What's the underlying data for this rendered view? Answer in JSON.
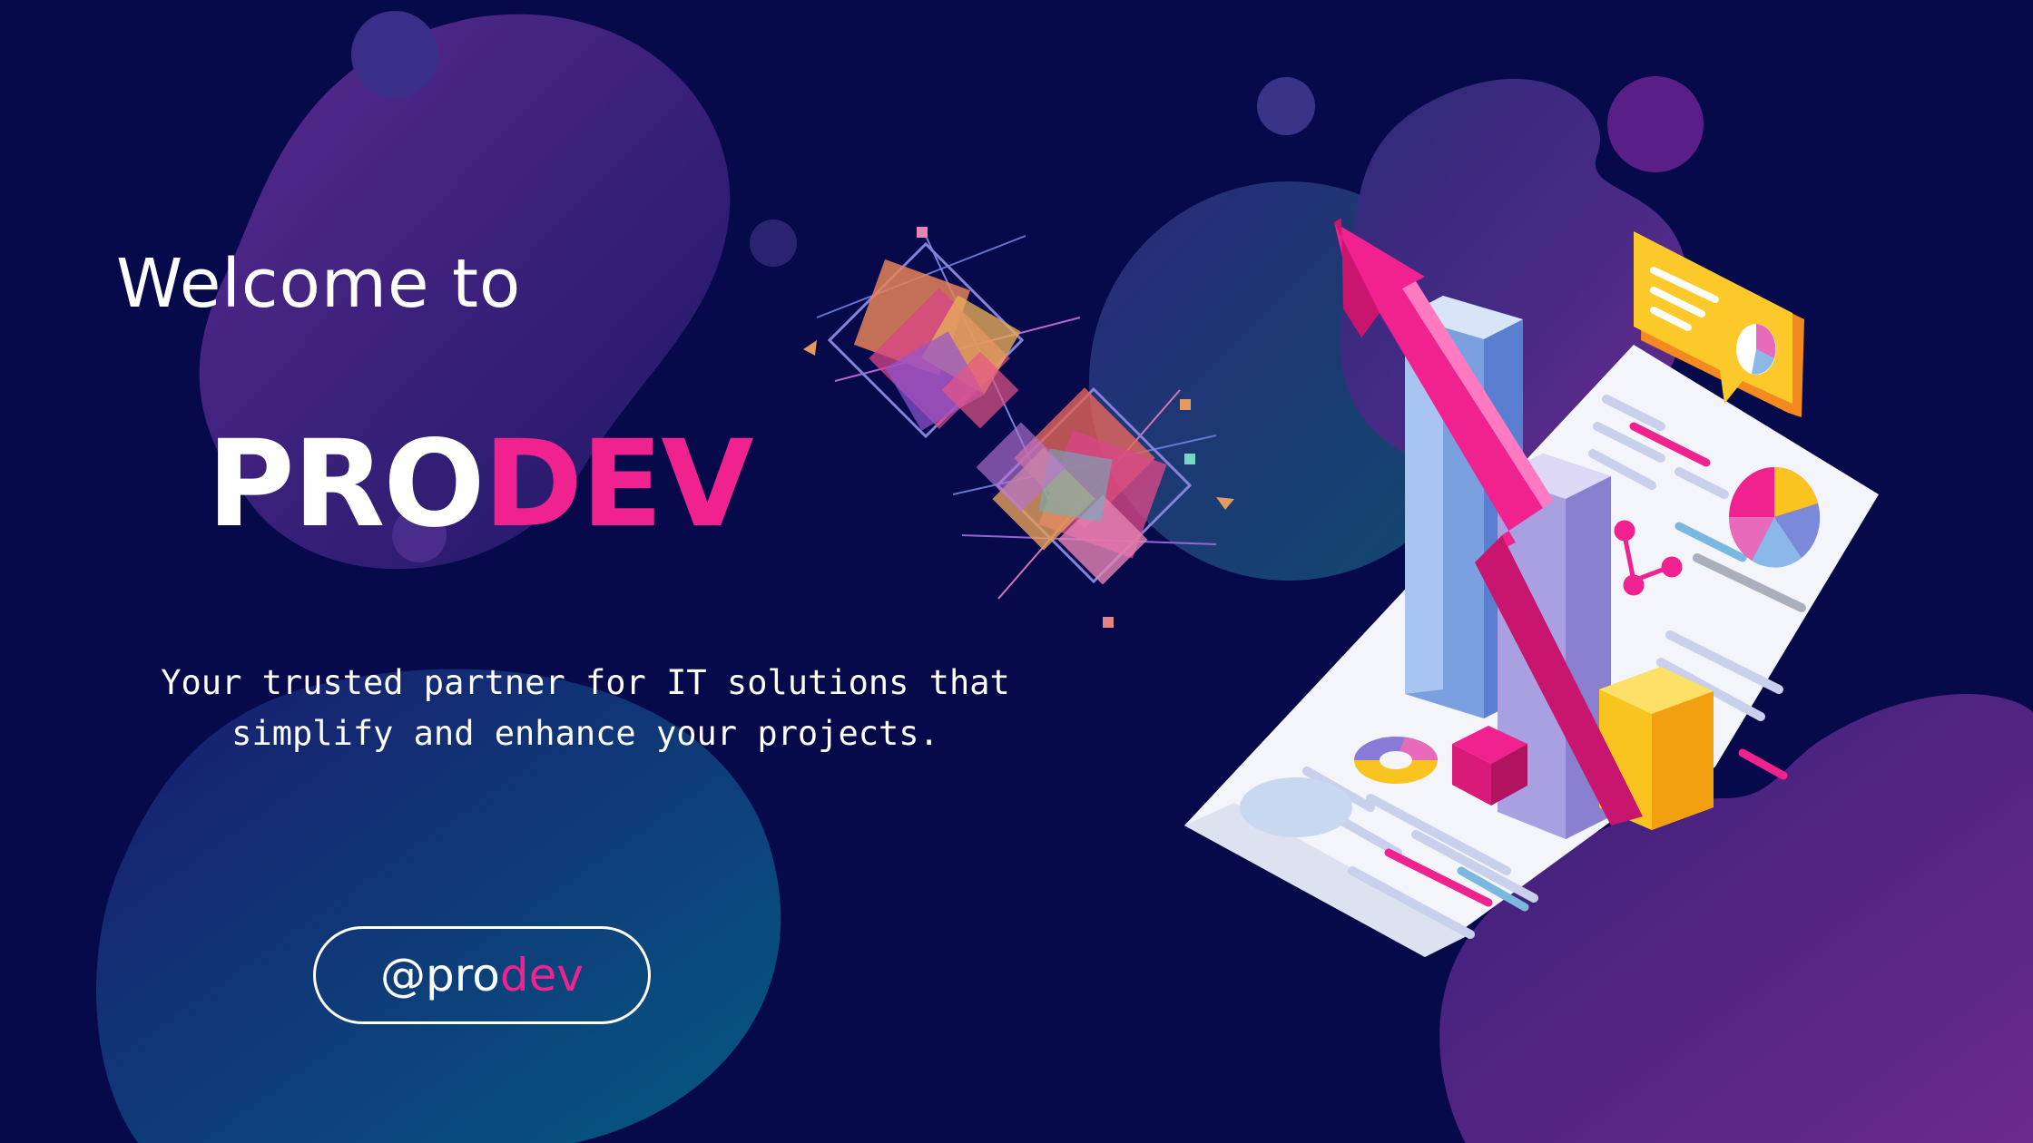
{
  "hero": {
    "welcome": "Welcome to",
    "brand_part1": "PRO",
    "brand_part2": "DEV",
    "tagline": "Your trusted partner for IT solutions that simplify and enhance your projects."
  },
  "handle_button": {
    "prefix": "@pro",
    "suffix": "dev"
  },
  "illustration": {
    "name": "growth-analytics-illustration"
  },
  "colors": {
    "background": "#06094a",
    "accent": "#f0228f",
    "text": "#ffffff"
  }
}
